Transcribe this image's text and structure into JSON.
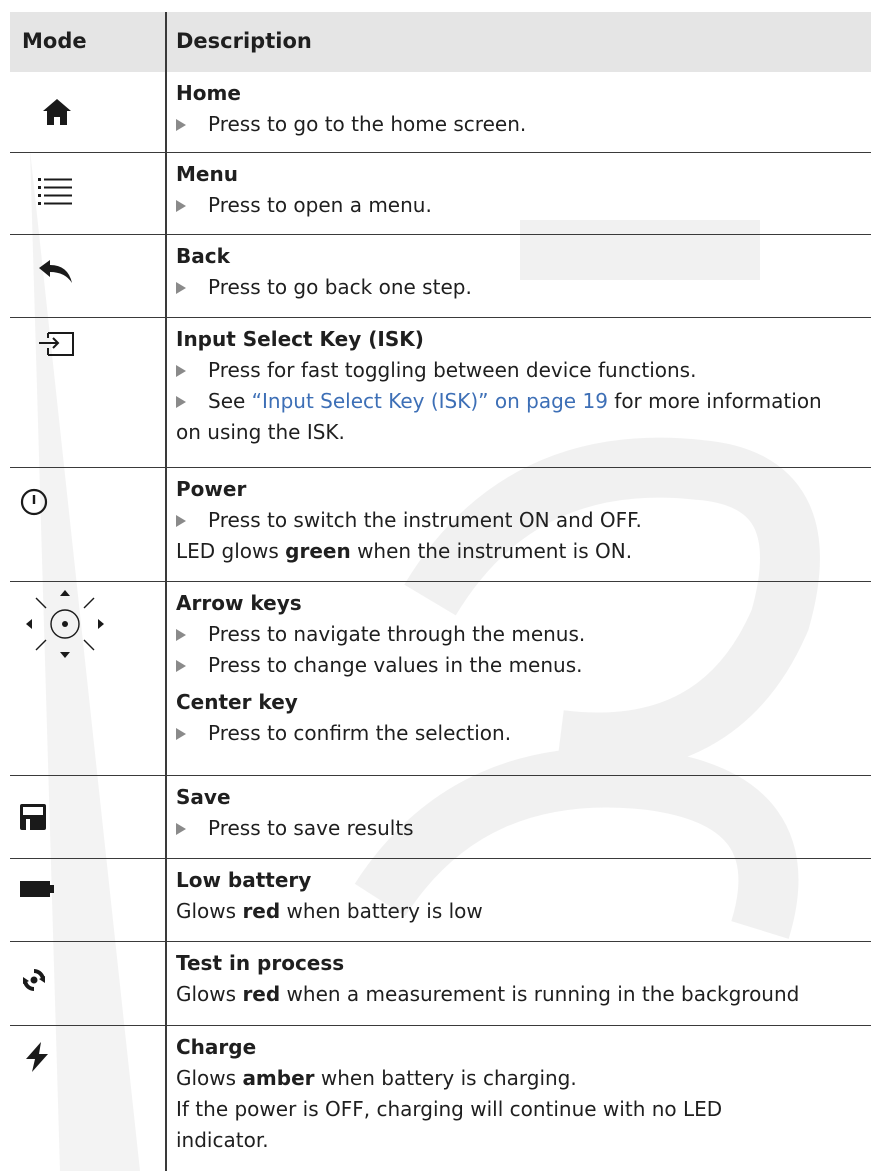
{
  "header": {
    "mode": "Mode",
    "description": "Description"
  },
  "rows": [
    {
      "icon": "home-icon",
      "title": "Home",
      "bullets": [
        "Press to go to the home screen."
      ]
    },
    {
      "icon": "menu-icon",
      "title": "Menu",
      "bullets": [
        "Press to open a menu."
      ]
    },
    {
      "icon": "back-icon",
      "title": "Back",
      "bullets": [
        "Press to go back one step."
      ]
    },
    {
      "icon": "input-select-icon",
      "title": "Input Select Key (ISK)",
      "bullets": [
        "Press for fast toggling between device functions."
      ],
      "see_prefix": "See ",
      "see_link": "“Input Select Key (ISK)” on page 19",
      "see_suffix": " for more information",
      "see_line2": "on using the ISK."
    },
    {
      "icon": "power-icon",
      "title": "Power",
      "bullets": [
        "Press to switch the instrument ON and OFF."
      ],
      "note_prefix": "LED glows ",
      "note_bold": "green",
      "note_suffix": " when the instrument is ON."
    },
    {
      "icon": "arrow-keys-icon",
      "title": "Arrow keys",
      "bullets": [
        "Press to navigate through the menus.",
        "Press to change values in the menus."
      ],
      "sub_title": "Center key",
      "sub_bullets": [
        "Press to confirm the selection."
      ]
    },
    {
      "icon": "save-icon",
      "title": "Save",
      "bullets": [
        "Press to save results"
      ]
    },
    {
      "icon": "battery-icon",
      "title": "Low battery",
      "note_prefix": "Glows ",
      "note_bold": "red",
      "note_suffix": " when battery is low"
    },
    {
      "icon": "test-in-process-icon",
      "title": "Test in process",
      "note_prefix": "Glows ",
      "note_bold": "red",
      "note_suffix": " when a measurement is running in the background"
    },
    {
      "icon": "charge-icon",
      "title": "Charge",
      "note_prefix": "Glows ",
      "note_bold": "amber",
      "note_suffix": " when battery is charging.",
      "extra_line1": "If the power is OFF, charging will continue with no LED",
      "extra_line2": "indicator."
    }
  ],
  "colors": {
    "link": "#3d6fb6",
    "bullet": "#8a8a8a",
    "rule": "#3a3a3a",
    "header_bg": "#dcdcdc"
  }
}
